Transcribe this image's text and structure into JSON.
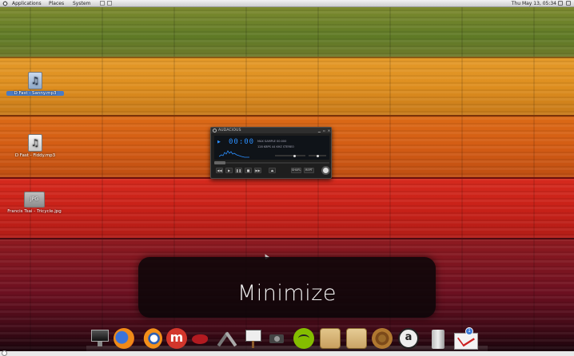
{
  "top_panel": {
    "menus": [
      "Applications",
      "Places",
      "System"
    ],
    "clock": "Thu May 13, 05:34"
  },
  "desktop": {
    "icons": [
      {
        "label": "D Fast - Sanny.mp3",
        "selected": true,
        "type": "audio",
        "glyph": "♫"
      },
      {
        "label": "D Fast - Fiddy.mp3",
        "selected": false,
        "type": "audio",
        "glyph": "♫"
      },
      {
        "label": "Francis Tsai - Tricycle.jpg",
        "selected": false,
        "type": "image",
        "glyph": "JPG"
      }
    ]
  },
  "player": {
    "title": "AUDACIOUS",
    "time": "00:00",
    "info_line1": "MAX  SAMPLE  00:000",
    "info_line2": "128 KBPS  44 KHZ  STEREO",
    "controls": [
      "◀◀",
      "▶",
      "❚❚",
      "■",
      "▶▶",
      "⏏"
    ],
    "toggles": [
      "SHUFL",
      "REPT"
    ],
    "seek_position_fraction": 0.05,
    "volume_fraction": 0.6
  },
  "osd": {
    "text": "Minimize"
  },
  "dock": {
    "items": [
      "monitor-icon",
      "firefox-icon",
      "blender-icon",
      "m-app-icon",
      "bird-icon",
      "tools-icon",
      "easel-icon",
      "camera-icon",
      "spotify-icon",
      "folder-icon",
      "folder-icon",
      "gear-icon",
      "amazon-icon",
      "trash-icon",
      "mail-icon"
    ],
    "mail_badge": "1"
  },
  "colors": {
    "player_accent": "#2b8fff",
    "selection": "#4a7bc4"
  }
}
